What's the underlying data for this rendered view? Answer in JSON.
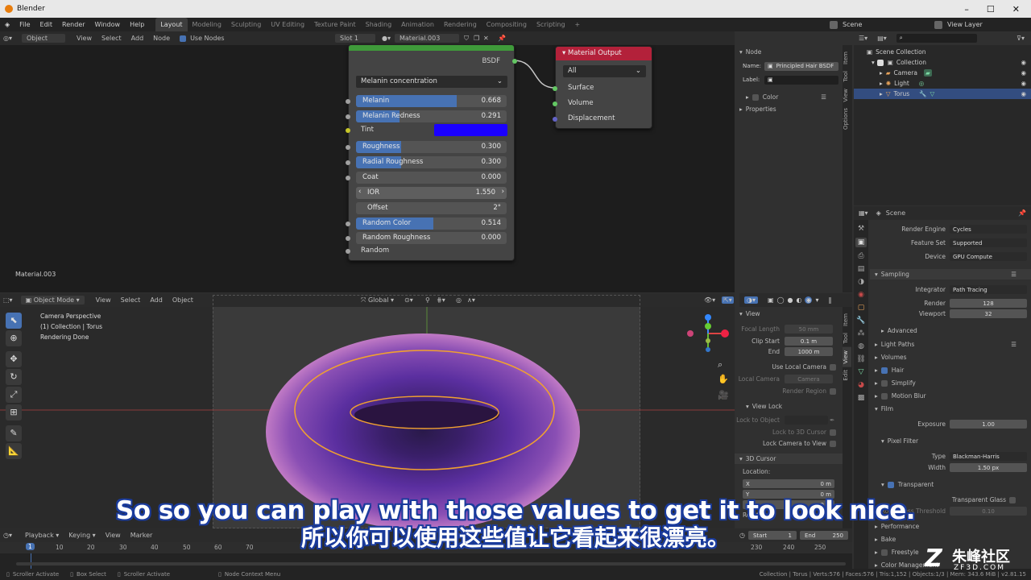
{
  "app": {
    "title": "Blender",
    "menus": [
      "File",
      "Edit",
      "Render",
      "Window",
      "Help"
    ],
    "workspaces": [
      "Layout",
      "Modeling",
      "Sculpting",
      "UV Editing",
      "Texture Paint",
      "Shading",
      "Animation",
      "Rendering",
      "Compositing",
      "Scripting"
    ],
    "scene": "Scene",
    "view_layer": "View Layer"
  },
  "node_editor": {
    "mode": "Object",
    "menus": [
      "View",
      "Select",
      "Add",
      "Node"
    ],
    "use_nodes": "Use Nodes",
    "slot": "Slot 1",
    "material": "Material.003",
    "label": "Material.003"
  },
  "hair_node": {
    "output": "BSDF",
    "parametrization": "Melanin concentration",
    "fields": [
      {
        "label": "Melanin",
        "value": "0.668",
        "fill": 0.668
      },
      {
        "label": "Melanin Redness",
        "value": "0.291",
        "fill": 0.291
      },
      {
        "label": "Roughness",
        "value": "0.300",
        "fill": 0.3
      },
      {
        "label": "Radial Roughness",
        "value": "0.300",
        "fill": 0.3
      },
      {
        "label": "Coat",
        "value": "0.000",
        "fill": 0
      },
      {
        "label": "IOR",
        "value": "1.550",
        "fill": 0
      },
      {
        "label": "Offset",
        "value": "2°",
        "fill": 0
      },
      {
        "label": "Random Color",
        "value": "0.514",
        "fill": 0.514
      },
      {
        "label": "Random Roughness",
        "value": "0.000",
        "fill": 0
      }
    ],
    "tint": "Tint",
    "tint_color": "#1a00ff",
    "random": "Random"
  },
  "material_output": {
    "title": "Material Output",
    "target": "All",
    "inputs": [
      "Surface",
      "Volume",
      "Displacement"
    ]
  },
  "node_sidebar": {
    "section": "Node",
    "name_label": "Name:",
    "name_value": "Principled Hair BSDF",
    "label_label": "Label:",
    "color": "Color",
    "properties": "Properties",
    "tabs": [
      "Item",
      "Tool",
      "View",
      "Options"
    ]
  },
  "outliner": {
    "root": "Scene Collection",
    "collection": "Collection",
    "items": [
      "Camera",
      "Light",
      "Torus"
    ]
  },
  "properties": {
    "scene": "Scene",
    "render_engine_label": "Render Engine",
    "render_engine": "Cycles",
    "feature_set_label": "Feature Set",
    "feature_set": "Supported",
    "device_label": "Device",
    "device": "GPU Compute",
    "sampling": "Sampling",
    "integrator_label": "Integrator",
    "integrator": "Path Tracing",
    "render_label": "Render",
    "render": "128",
    "viewport_label": "Viewport",
    "viewport": "32",
    "advanced": "Advanced",
    "light_paths": "Light Paths",
    "volumes": "Volumes",
    "hair": "Hair",
    "simplify": "Simplify",
    "motion_blur": "Motion Blur",
    "film": "Film",
    "exposure_label": "Exposure",
    "exposure": "1.00",
    "pixel_filter": "Pixel Filter",
    "type_label": "Type",
    "type": "Blackman-Harris",
    "width_label": "Width",
    "width": "1.50 px",
    "transparent": "Transparent",
    "transparent_glass": "Transparent Glass",
    "roughness_threshold": "Roughness Threshold",
    "roughness_threshold_value": "0.10",
    "performance": "Performance",
    "bake": "Bake",
    "freestyle": "Freestyle",
    "color_management": "Color Management"
  },
  "viewport": {
    "mode": "Object Mode",
    "menus": [
      "View",
      "Select",
      "Add",
      "Object"
    ],
    "orientation": "Global",
    "info": [
      "Camera Perspective",
      "(1) Collection | Torus",
      "Rendering Done"
    ]
  },
  "view_sidebar": {
    "view": "View",
    "focal_length": "Focal Length",
    "focal_value": "50 mm",
    "clip_start": "Clip Start",
    "clip_start_value": "0.1 m",
    "clip_end": "End",
    "clip_end_value": "1000 m",
    "use_local_camera": "Use Local Camera",
    "local_camera": "Local Camera",
    "camera": "Camera",
    "render_border": "Render Region",
    "view_lock": "View Lock",
    "lock_object": "Lock to Object",
    "lock_cursor": "Lock to 3D Cursor",
    "lock_camera": "Lock Camera to View",
    "cursor": "3D Cursor",
    "location": "Location:",
    "x": "X",
    "y": "Y",
    "x_val": "0 m",
    "y_val": "0 m",
    "z_val": "0 m",
    "rotation": "Rotation",
    "tabs": [
      "Item",
      "Tool",
      "View",
      "Edit"
    ]
  },
  "timeline": {
    "menus": [
      "Playback",
      "Keying",
      "View",
      "Marker"
    ],
    "frame": "1",
    "ticks": [
      "10",
      "20",
      "30",
      "40",
      "50",
      "60",
      "70"
    ],
    "ticks_right": [
      "230",
      "240",
      "250"
    ],
    "start_label": "Start",
    "start": "1",
    "end_label": "End",
    "end": "250"
  },
  "statusbar": {
    "left": [
      "Scroller Activate",
      "Box Select",
      "Scroller Activate",
      "Node Context Menu"
    ],
    "right": "Collection | Torus | Verts:576 | Faces:576 | Tris:1,152 | Objects:1/3 | Mem: 343.6 MiB | v2.81.15"
  },
  "subtitle": {
    "en": "So so you can play with those values to get it to look nice.",
    "zh": "所以你可以使用这些值让它看起来很漂亮。"
  },
  "watermark": {
    "brand": "朱峰社区",
    "url": "ZF3D.COM"
  }
}
